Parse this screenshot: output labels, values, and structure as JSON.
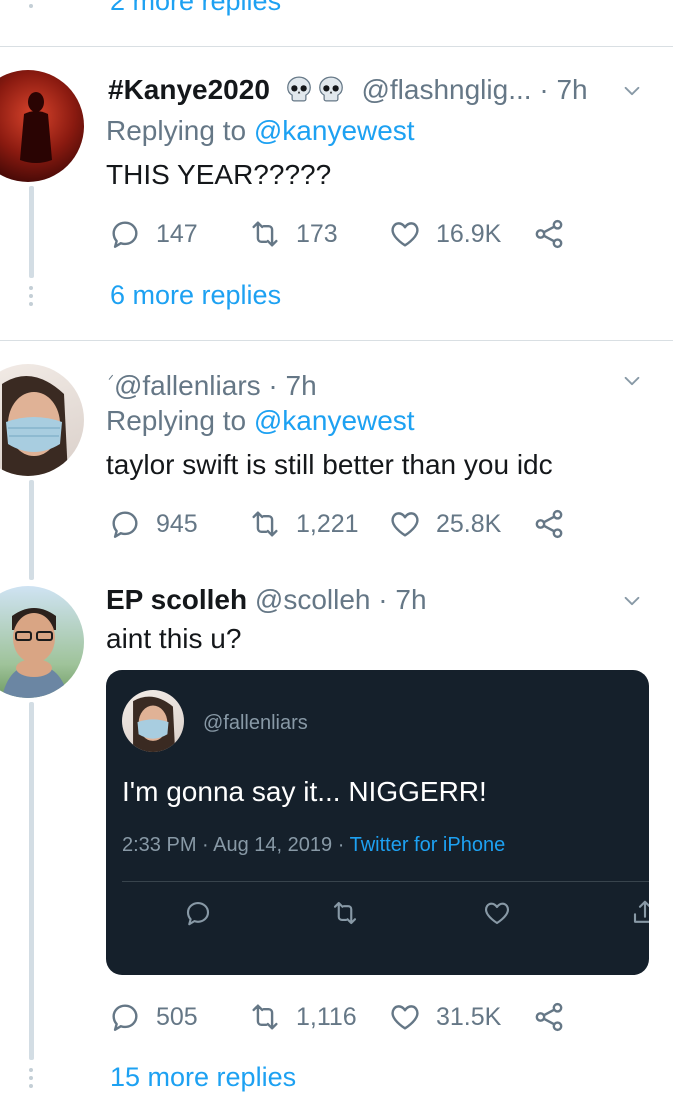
{
  "top": {
    "more_replies": "2 more replies"
  },
  "tweets": [
    {
      "name": "#Kanye2020",
      "emoji": "💀💀",
      "handle": "@flashnglig...",
      "sep": "·",
      "time": "7h",
      "replying_prefix": "Replying to",
      "replying_to": "@kanyewest",
      "text": "THIS YEAR?????",
      "replies": "147",
      "retweets": "173",
      "likes": "16.9K",
      "more_replies": "6 more replies"
    },
    {
      "name": "",
      "name_mark": "ᐟ",
      "handle": "@fallenliars",
      "sep": "·",
      "time": "7h",
      "replying_prefix": "Replying to",
      "replying_to": "@kanyewest",
      "text": "taylor swift is still better than you idc",
      "replies": "945",
      "retweets": "1,221",
      "likes": "25.8K"
    },
    {
      "name": "EP scolleh",
      "handle": "@scolleh",
      "sep": "·",
      "time": "7h",
      "text": "aint this u?",
      "replies": "505",
      "retweets": "1,116",
      "likes": "31.5K",
      "more_replies": "15 more replies"
    }
  ],
  "quoted_screenshot": {
    "handle": "@fallenliars",
    "text": "I'm gonna say it... NIGGERR!",
    "time": "2:33 PM · Aug 14, 2019 ·",
    "source": "Twitter for iPhone"
  },
  "icons": {
    "reply": "reply-icon",
    "retweet": "retweet-icon",
    "like": "heart-icon",
    "share": "share-icon",
    "menu": "chevron-down-icon"
  },
  "colors": {
    "link": "#1da1f2",
    "muted": "#657786",
    "card_bg": "#15202b"
  }
}
